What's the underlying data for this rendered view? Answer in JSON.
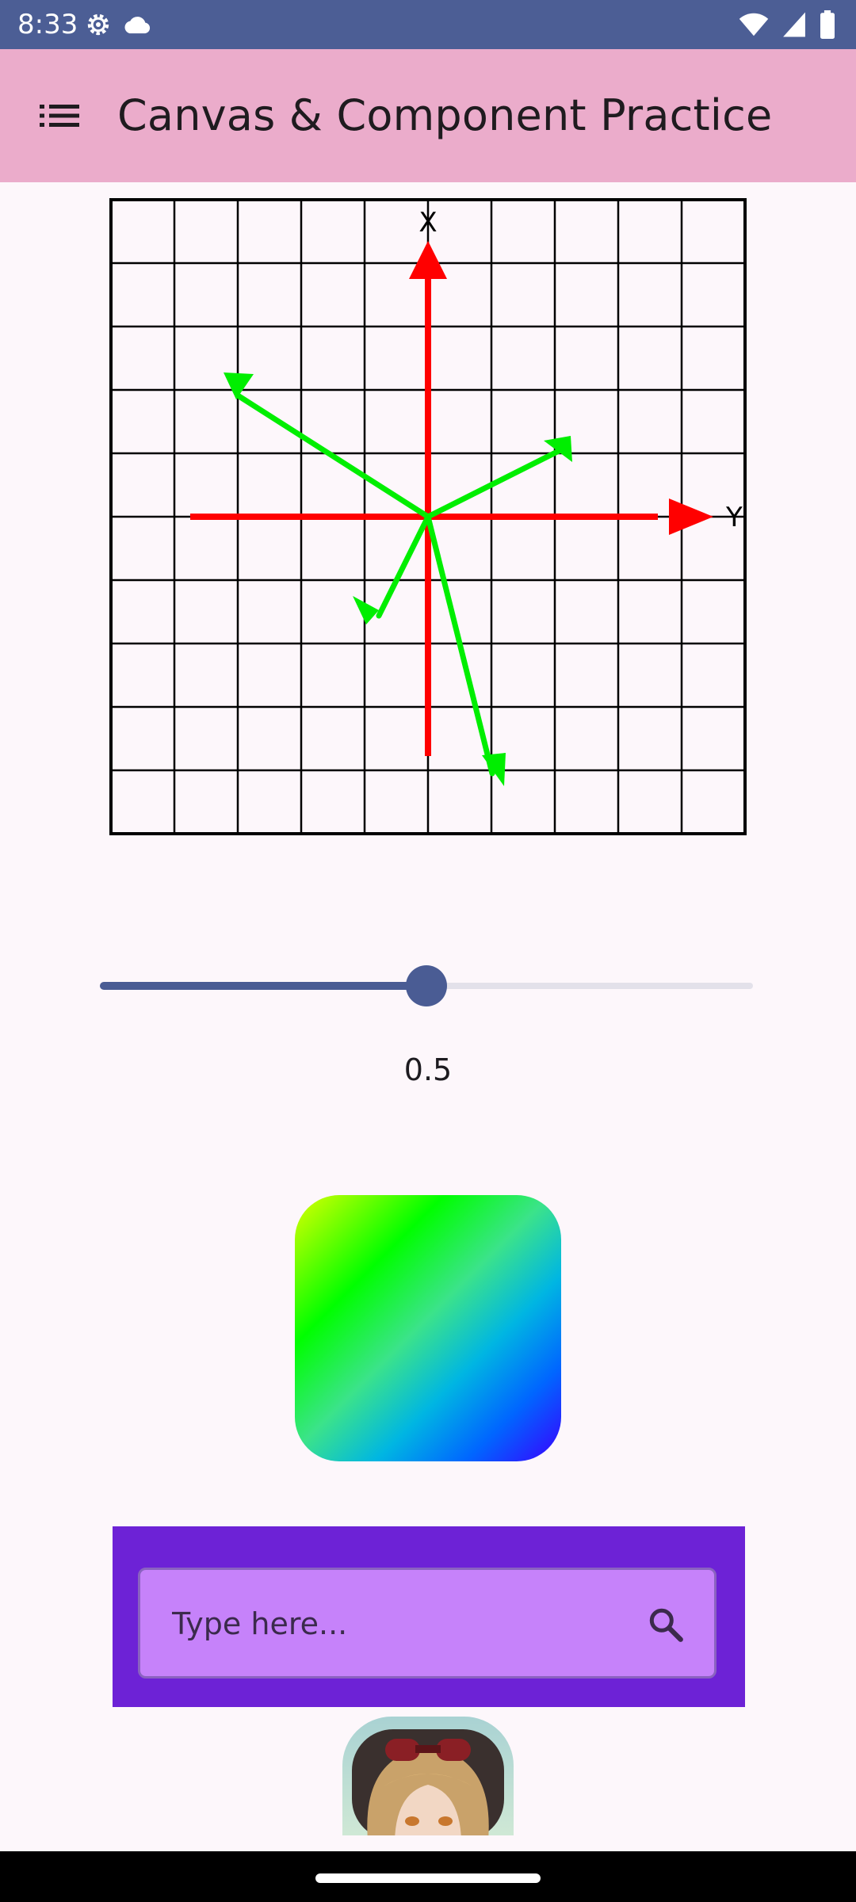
{
  "status_bar": {
    "time": "8:33",
    "left_icons": [
      "settings-icon",
      "cloud-icon"
    ],
    "right_icons": [
      "wifi-icon",
      "cell-signal-icon",
      "battery-icon"
    ]
  },
  "app_bar": {
    "title": "Canvas & Component Practice",
    "menu_icon": "list-icon"
  },
  "graph": {
    "grid_lines": true,
    "x_axis_label": "X",
    "y_axis_label": "Y",
    "axis_color": "#ff0000",
    "vector_color": "#00ff00"
  },
  "slider": {
    "value": 0.5,
    "value_label": "0.5",
    "active_color": "#4a5c94"
  },
  "gradient_box": {
    "colors": [
      "#ddff00",
      "#00ff00",
      "#3be38a",
      "#00b6e2",
      "#0066ff",
      "#3a00ff"
    ]
  },
  "search": {
    "placeholder": "Type here...",
    "value": "",
    "icon": "search-icon",
    "container_color": "#6d22d6",
    "field_color": "#c682fa"
  },
  "avatar": {
    "icon": "avatar-image"
  }
}
